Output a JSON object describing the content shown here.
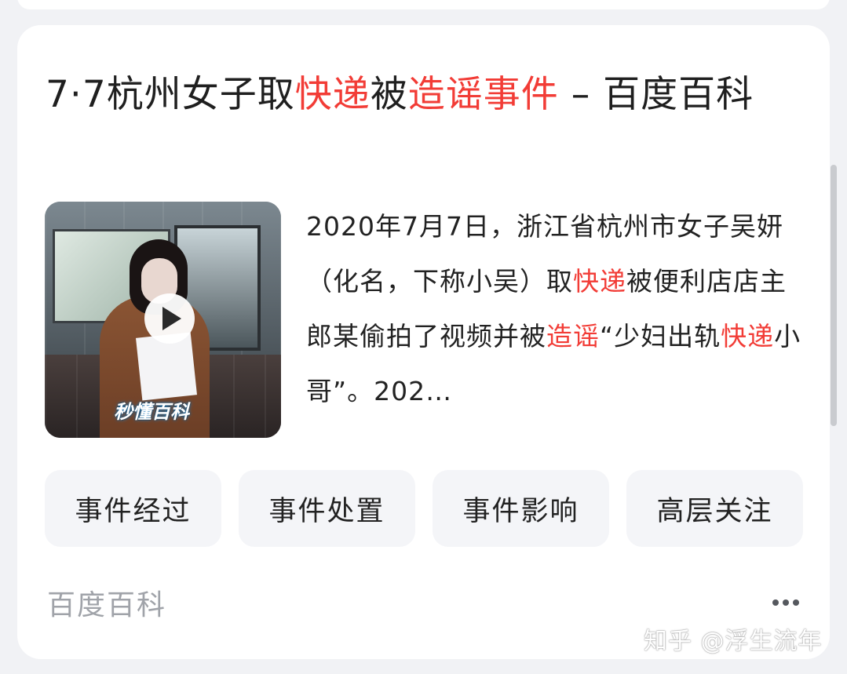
{
  "result": {
    "title_parts": [
      {
        "text": "7·7杭州女子取",
        "highlight": false
      },
      {
        "text": "快递",
        "highlight": true
      },
      {
        "text": "被",
        "highlight": false
      },
      {
        "text": "造谣事件",
        "highlight": true
      },
      {
        "text": " – 百度百科",
        "highlight": false
      }
    ],
    "thumbnail_logo": "秒懂百科",
    "description_parts": [
      {
        "text": "2020年7月7日，浙江省杭州市女子吴妍（化名，下称小吴）取",
        "highlight": false
      },
      {
        "text": "快递",
        "highlight": true
      },
      {
        "text": "被便利店店主郎某偷拍了视频并被",
        "highlight": false
      },
      {
        "text": "造谣",
        "highlight": true
      },
      {
        "text": "“少妇出轨",
        "highlight": false
      },
      {
        "text": "快递",
        "highlight": true
      },
      {
        "text": "小哥”。202…",
        "highlight": false
      }
    ],
    "tags": [
      "事件经过",
      "事件处置",
      "事件影响",
      "高层关注"
    ],
    "source": "百度百科"
  },
  "watermark": "知乎 @浮生流年",
  "colors": {
    "highlight": "#f23c36",
    "background": "#f1f2f5",
    "card": "#ffffff",
    "tag_bg": "#f4f5f8"
  },
  "icons": {
    "play": "play-icon",
    "more": "more-dots-icon"
  }
}
